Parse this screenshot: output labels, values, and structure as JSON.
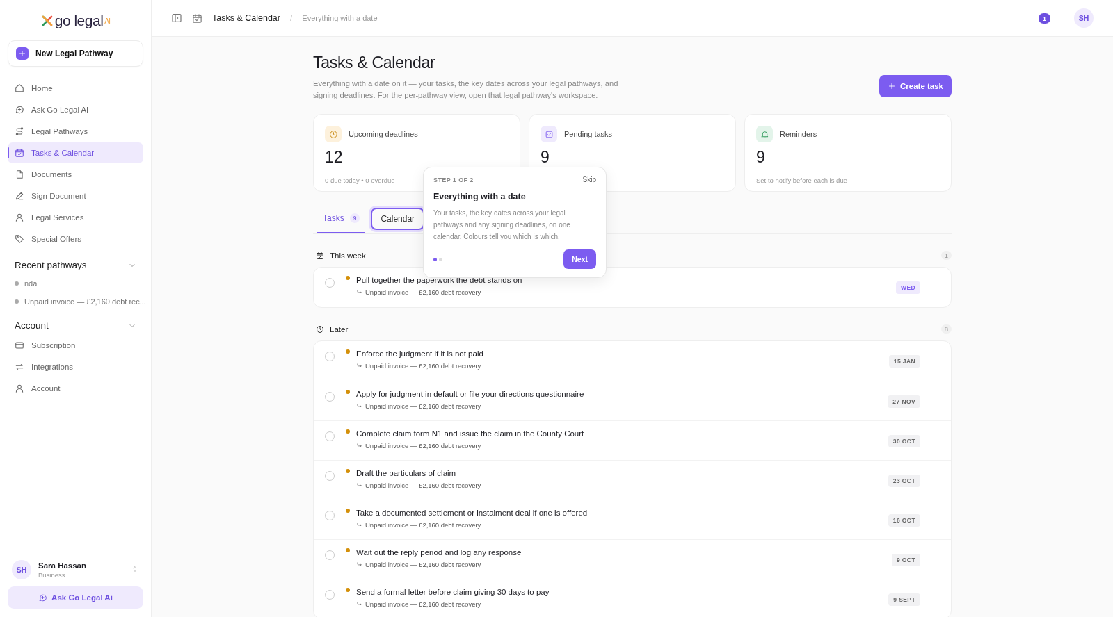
{
  "sidebar": {
    "logo": {
      "text": "go legal",
      "superscript": "Ai"
    },
    "new_button": {
      "label": "New Legal Pathway"
    },
    "nav": [
      {
        "label": "Home",
        "selected": false
      },
      {
        "label": "Ask Go Legal Ai",
        "selected": false
      },
      {
        "label": "Legal Pathways",
        "selected": false
      },
      {
        "label": "Tasks & Calendar",
        "selected": true
      },
      {
        "label": "Documents",
        "selected": false
      },
      {
        "label": "Sign Document",
        "selected": false
      },
      {
        "label": "Legal Services",
        "selected": false
      },
      {
        "label": "Special Offers",
        "selected": false
      }
    ],
    "recent": {
      "title": "Recent pathways",
      "expanded": true,
      "items": [
        "nda",
        "Unpaid invoice — £2,160 debt rec..."
      ]
    },
    "account": {
      "title": "Account",
      "expanded": true,
      "items": [
        "Subscription",
        "Integrations",
        "Account"
      ]
    },
    "user": {
      "initials": "SH",
      "name": "Sara Hassan",
      "plan": "Business"
    },
    "ask_button": {
      "label": "Ask Go Legal Ai"
    }
  },
  "topbar": {
    "title": "Tasks & Calendar",
    "separator": "/",
    "subtitle": "Everything with a date",
    "notifications": "1",
    "avatar": "SH"
  },
  "page": {
    "title": "Tasks & Calendar",
    "description": "Everything with a date on it — your tasks, the key dates across your legal pathways, and signing deadlines. For the per-pathway view, open that legal pathway's workspace.",
    "create_button": "Create task"
  },
  "stats": [
    {
      "kind": "deadlines",
      "label": "Upcoming deadlines",
      "value": "12",
      "note": "0 due today • 0 overdue"
    },
    {
      "kind": "pending",
      "label": "Pending tasks",
      "value": "9"
    },
    {
      "kind": "reminders",
      "label": "Reminders",
      "value": "9",
      "note": "Set to notify before each is due"
    }
  ],
  "tabs": [
    {
      "label": "Tasks",
      "count": "9",
      "selected": true,
      "highlighted": false
    },
    {
      "label": "Calendar",
      "selected": false,
      "highlighted": true
    }
  ],
  "groups": [
    {
      "kind": "week",
      "title": "This week",
      "count": "1",
      "tasks": [
        {
          "title": "Pull together the paperwork the debt stands on",
          "pathway": "Unpaid invoice — £2,160 debt recovery",
          "date": "WED",
          "soon": true,
          "done": false
        }
      ]
    },
    {
      "kind": "later",
      "title": "Later",
      "count": "8",
      "tasks": [
        {
          "title": "Enforce the judgment if it is not paid",
          "pathway": "Unpaid invoice — £2,160 debt recovery",
          "date": "15 JAN",
          "soon": false,
          "done": false
        },
        {
          "title": "Apply for judgment in default or file your directions questionnaire",
          "pathway": "Unpaid invoice — £2,160 debt recovery",
          "date": "27 NOV",
          "soon": false,
          "done": false
        },
        {
          "title": "Complete claim form N1 and issue the claim in the County Court",
          "pathway": "Unpaid invoice — £2,160 debt recovery",
          "date": "30 OCT",
          "soon": false,
          "done": false
        },
        {
          "title": "Draft the particulars of claim",
          "pathway": "Unpaid invoice — £2,160 debt recovery",
          "date": "23 OCT",
          "soon": false,
          "done": false
        },
        {
          "title": "Take a documented settlement or instalment deal if one is offered",
          "pathway": "Unpaid invoice — £2,160 debt recovery",
          "date": "16 OCT",
          "soon": false,
          "done": false
        },
        {
          "title": "Wait out the reply period and log any response",
          "pathway": "Unpaid invoice — £2,160 debt recovery",
          "date": "9 OCT",
          "soon": false,
          "done": false
        },
        {
          "title": "Send a formal letter before claim giving 30 days to pay",
          "pathway": "Unpaid invoice — £2,160 debt recovery",
          "date": "9 SEPT",
          "soon": false,
          "done": false
        }
      ]
    }
  ],
  "tour": {
    "step": "STEP 1 OF 2",
    "skip": "Skip",
    "title": "Everything with a date",
    "body": "Your tasks, the key dates across your legal pathways and any signing deadlines, on one calendar. Colours tell you which is which.",
    "steps": [
      {
        "selected": true
      },
      {
        "selected": false
      }
    ],
    "next": "Next"
  }
}
